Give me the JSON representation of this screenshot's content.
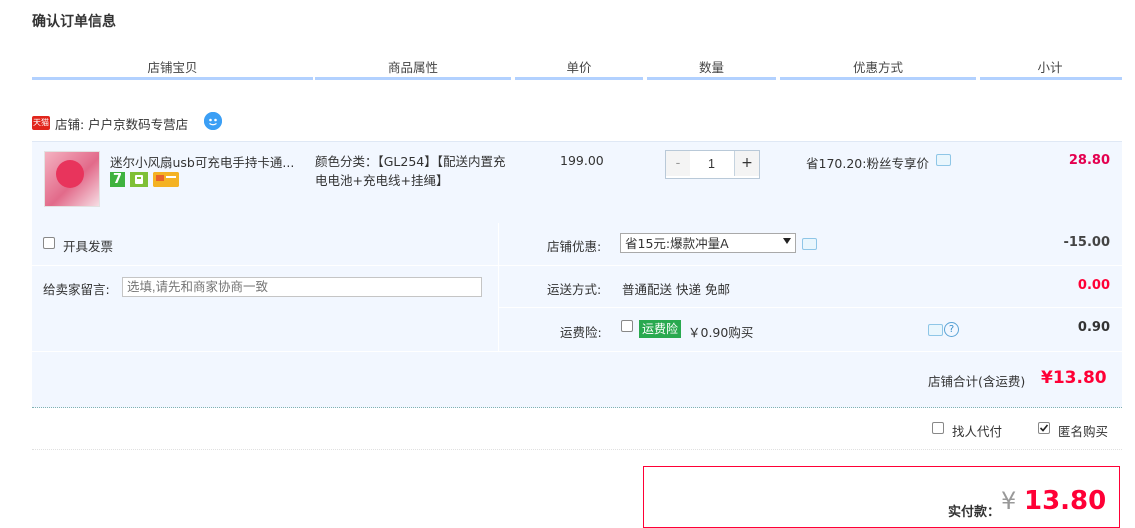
{
  "page": {
    "title": "确认订单信息"
  },
  "columns": [
    "店铺宝贝",
    "商品属性",
    "单价",
    "数量",
    "优惠方式",
    "小计"
  ],
  "shop": {
    "badge": "天猫",
    "name": "店铺: 户户京数码专营店"
  },
  "item": {
    "name": "迷尔小风扇usb可充电手持卡通...",
    "attributes": "颜色分类：【GL254】【配送内置充电电池+充电线+挂绳】",
    "service_icon_7": "7",
    "price": "199.00",
    "quantity": "1",
    "qty_minus": "-",
    "qty_plus": "+",
    "discount": "省170.20:粉丝专享价",
    "subtotal": "28.80"
  },
  "invoice": {
    "label": "开具发票",
    "checked": false
  },
  "note": {
    "label": "给卖家留言:",
    "placeholder": "选填,请先和商家协商一致"
  },
  "shop_discount": {
    "label": "店铺优惠:",
    "selected": "省15元:爆款冲量A",
    "value": "-15.00"
  },
  "shipping": {
    "label": "运送方式:",
    "method": "普通配送 快递 免邮",
    "value": "0.00"
  },
  "insurance": {
    "label": "运费险:",
    "badge": "运费险",
    "desc": "￥0.90购买",
    "value": "0.90"
  },
  "shop_total": {
    "label": "店铺合计(含运费)",
    "value": "¥13.80"
  },
  "options": {
    "proxy_pay": {
      "label": "找人代付",
      "checked": false
    },
    "anonymous": {
      "label": "匿名购买",
      "checked": true
    }
  },
  "payment": {
    "label": "实付款：",
    "currency": "¥",
    "amount": "13.80"
  },
  "colors": {
    "accent_red": "#ff0036",
    "panel_bg": "#f2f7ff",
    "header_line": "#b2d1ff",
    "badge_green": "#29a94f"
  }
}
